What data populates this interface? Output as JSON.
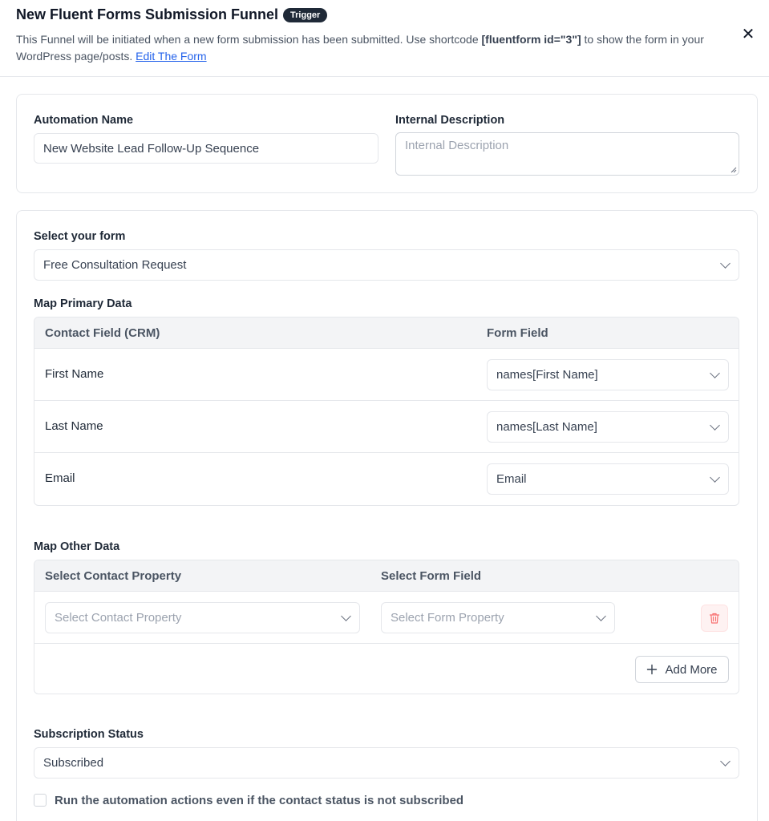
{
  "header": {
    "title": "New Fluent Forms Submission Funnel",
    "badge": "Trigger",
    "description_before": "This Funnel will be initiated when a new form submission has been submitted. Use shortcode ",
    "shortcode": "[fluentform id=\"3\"]",
    "description_after": " to show the form in your WordPress page/posts. ",
    "edit_link": "Edit The Form",
    "close_icon": "close-icon"
  },
  "settings": {
    "automation_name_label": "Automation Name",
    "automation_name_value": "New Website Lead Follow-Up Sequence",
    "internal_description_label": "Internal Description",
    "internal_description_placeholder": "Internal Description"
  },
  "form": {
    "select_form_label": "Select your form",
    "selected_form": "Free Consultation Request",
    "map_primary_label": "Map Primary Data",
    "primary_columns": [
      "Contact Field (CRM)",
      "Form Field"
    ],
    "primary_rows": [
      {
        "contact_field": "First Name",
        "form_field": "names[First Name]"
      },
      {
        "contact_field": "Last Name",
        "form_field": "names[Last Name]"
      },
      {
        "contact_field": "Email",
        "form_field": "Email"
      }
    ],
    "map_other_label": "Map Other Data",
    "other_columns": [
      "Select Contact Property",
      "Select Form Field"
    ],
    "contact_property_placeholder": "Select Contact Property",
    "form_property_placeholder": "Select Form Property",
    "delete_icon": "trash-icon",
    "add_more_label": "Add More",
    "add_icon": "plus-icon",
    "subscription_status_label": "Subscription Status",
    "subscription_status_value": "Subscribed",
    "run_anyway_label": "Run the automation actions even if the contact status is not subscribed"
  },
  "colors": {
    "accent_link": "#2563eb",
    "badge_bg": "#1f2937",
    "trash_red": "#f87171"
  }
}
